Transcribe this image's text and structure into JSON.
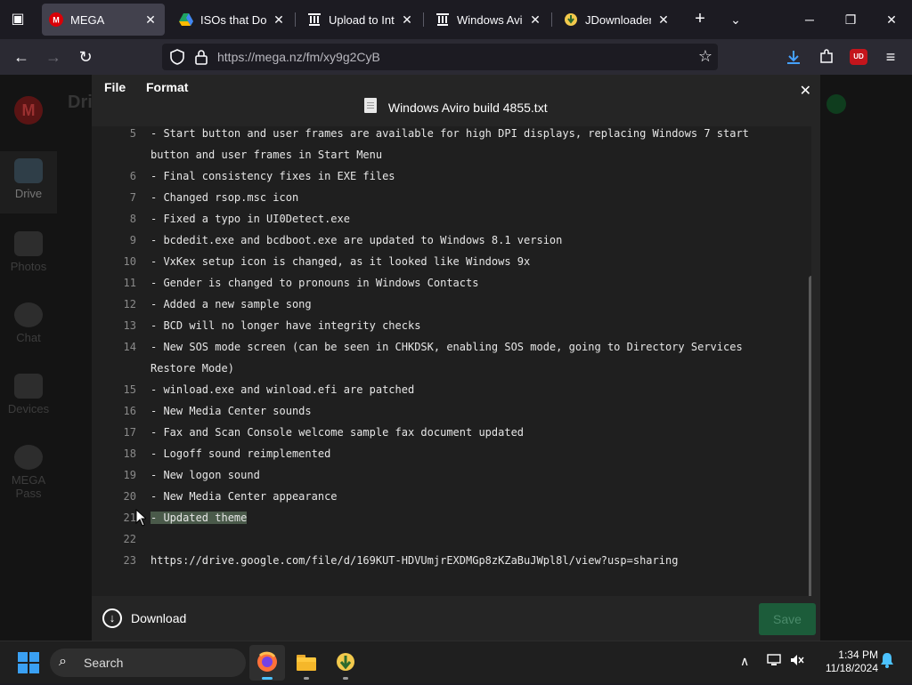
{
  "browser": {
    "tabs": [
      {
        "title": "MEGA",
        "favicon": "mega-icon",
        "active": true
      },
      {
        "title": "ISOs that Don't I",
        "favicon": "google-drive-icon",
        "active": false
      },
      {
        "title": "Upload to Intern",
        "favicon": "archive-icon",
        "active": false
      },
      {
        "title": "Windows Aviro I",
        "favicon": "archive-icon",
        "active": false
      },
      {
        "title": "JDownloader - C",
        "favicon": "jdownloader-icon",
        "active": false
      }
    ],
    "url": "https://mega.nz/fm/xy9g2CyB",
    "extension_badge": "UD"
  },
  "editor": {
    "menu": {
      "file": "File",
      "format": "Format"
    },
    "file_name": "Windows Aviro build 4855.txt",
    "lines": [
      {
        "n": "5",
        "text": "- Start button and user frames are available for high DPI displays, replacing Windows 7 start button and user frames in Start Menu"
      },
      {
        "n": "6",
        "text": "- Final consistency fixes in EXE files"
      },
      {
        "n": "7",
        "text": "- Changed rsop.msc icon"
      },
      {
        "n": "8",
        "text": "- Fixed a typo in UI0Detect.exe"
      },
      {
        "n": "9",
        "text": "- bcdedit.exe and bcdboot.exe are updated to Windows 8.1 version"
      },
      {
        "n": "10",
        "text": "- VxKex setup icon is changed, as it looked like Windows 9x"
      },
      {
        "n": "11",
        "text": "- Gender is changed to pronouns in Windows Contacts"
      },
      {
        "n": "12",
        "text": "- Added a new sample song"
      },
      {
        "n": "13",
        "text": "- BCD will no longer have integrity checks"
      },
      {
        "n": "14",
        "text": "- New SOS mode screen (can be seen in CHKDSK, enabling SOS mode, going to Directory Services Restore Mode)"
      },
      {
        "n": "15",
        "text": "- winload.exe and winload.efi are patched"
      },
      {
        "n": "16",
        "text": "- New Media Center sounds"
      },
      {
        "n": "17",
        "text": "- Fax and Scan Console welcome sample fax document updated"
      },
      {
        "n": "18",
        "text": "- Logoff sound reimplemented"
      },
      {
        "n": "19",
        "text": "- New logon sound"
      },
      {
        "n": "20",
        "text": "- New Media Center appearance"
      },
      {
        "n": "21",
        "text": "- Updated theme"
      },
      {
        "n": "22",
        "text": ""
      },
      {
        "n": "23",
        "text": "https://drive.google.com/file/d/169KUT-HDVUmjrEXDMGp8zKZaBuJWpl8l/view?usp=sharing"
      }
    ],
    "download_label": "Download",
    "save_label": "Save"
  },
  "mega_background": {
    "title": "Dri",
    "sidebar": [
      "Drive",
      "Photos",
      "Chat",
      "Devices",
      "MEGA Pass"
    ]
  },
  "taskbar": {
    "search_placeholder": "Search",
    "time": "1:34 PM",
    "date": "11/18/2024"
  },
  "colors": {
    "accent": "#4cc2ff",
    "mega_red": "#d90007",
    "save_green": "#1c5c3a",
    "selection": "#4a5a4a"
  }
}
